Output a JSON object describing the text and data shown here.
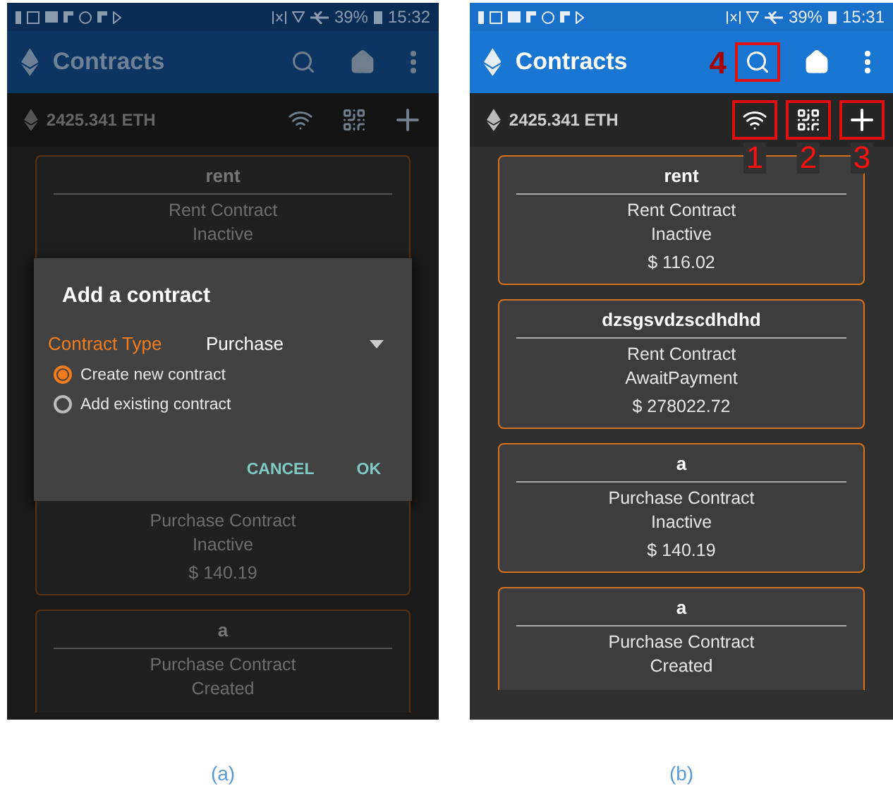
{
  "panels": [
    {
      "caption": "(a)",
      "dimmed": true,
      "status_bar": {
        "battery": "39%",
        "time": "15:32"
      },
      "app_bar": {
        "title": "Contracts",
        "actions": [
          {
            "kind": "search"
          },
          {
            "kind": "home"
          },
          {
            "kind": "more"
          }
        ]
      },
      "balance": {
        "amount": "2425.341 ETH",
        "actions": [
          {
            "kind": "wifi"
          },
          {
            "kind": "qr"
          },
          {
            "kind": "add"
          }
        ]
      },
      "content": [
        {
          "kind": "card",
          "open_top": false,
          "open_bottom": true,
          "title": "rent",
          "lines": [
            "Rent Contract",
            "Inactive"
          ]
        },
        {
          "kind": "dialog",
          "title": "Add a contract",
          "field_label": "Contract Type",
          "field_value": "Purchase",
          "options": [
            {
              "label": "Create new contract",
              "selected": true
            },
            {
              "label": "Add existing contract",
              "selected": false
            }
          ],
          "buttons": [
            "CANCEL",
            "OK"
          ]
        },
        {
          "kind": "card",
          "open_top": true,
          "open_bottom": false,
          "lines": [
            "Purchase Contract",
            "Inactive"
          ],
          "amount": "$ 140.19"
        },
        {
          "kind": "card",
          "open_top": false,
          "open_bottom": true,
          "title": "a",
          "lines": [
            "Purchase Contract",
            "Created"
          ]
        }
      ]
    },
    {
      "caption": "(b)",
      "dimmed": false,
      "status_bar": {
        "battery": "39%",
        "time": "15:31"
      },
      "app_bar": {
        "title": "Contracts",
        "actions": [
          {
            "kind": "search",
            "callout": "4"
          },
          {
            "kind": "home"
          },
          {
            "kind": "more"
          }
        ]
      },
      "balance": {
        "amount": "2425.341 ETH",
        "actions": [
          {
            "kind": "wifi",
            "callout": "1"
          },
          {
            "kind": "qr",
            "callout": "2"
          },
          {
            "kind": "add",
            "callout": "3"
          }
        ]
      },
      "content": [
        {
          "kind": "card",
          "open_top": false,
          "open_bottom": false,
          "title": "rent",
          "lines": [
            "Rent Contract",
            "Inactive"
          ],
          "amount": "$ 116.02"
        },
        {
          "kind": "card",
          "open_top": false,
          "open_bottom": false,
          "title": "dzsgsvdzscdhdhd",
          "lines": [
            "Rent Contract",
            "AwaitPayment"
          ],
          "amount": "$ 278022.72"
        },
        {
          "kind": "card",
          "open_top": false,
          "open_bottom": false,
          "title": "a",
          "lines": [
            "Purchase Contract",
            "Inactive"
          ],
          "amount": "$ 140.19"
        },
        {
          "kind": "card",
          "open_top": false,
          "open_bottom": true,
          "title": "a",
          "lines": [
            "Purchase Contract",
            "Created"
          ]
        }
      ]
    }
  ]
}
